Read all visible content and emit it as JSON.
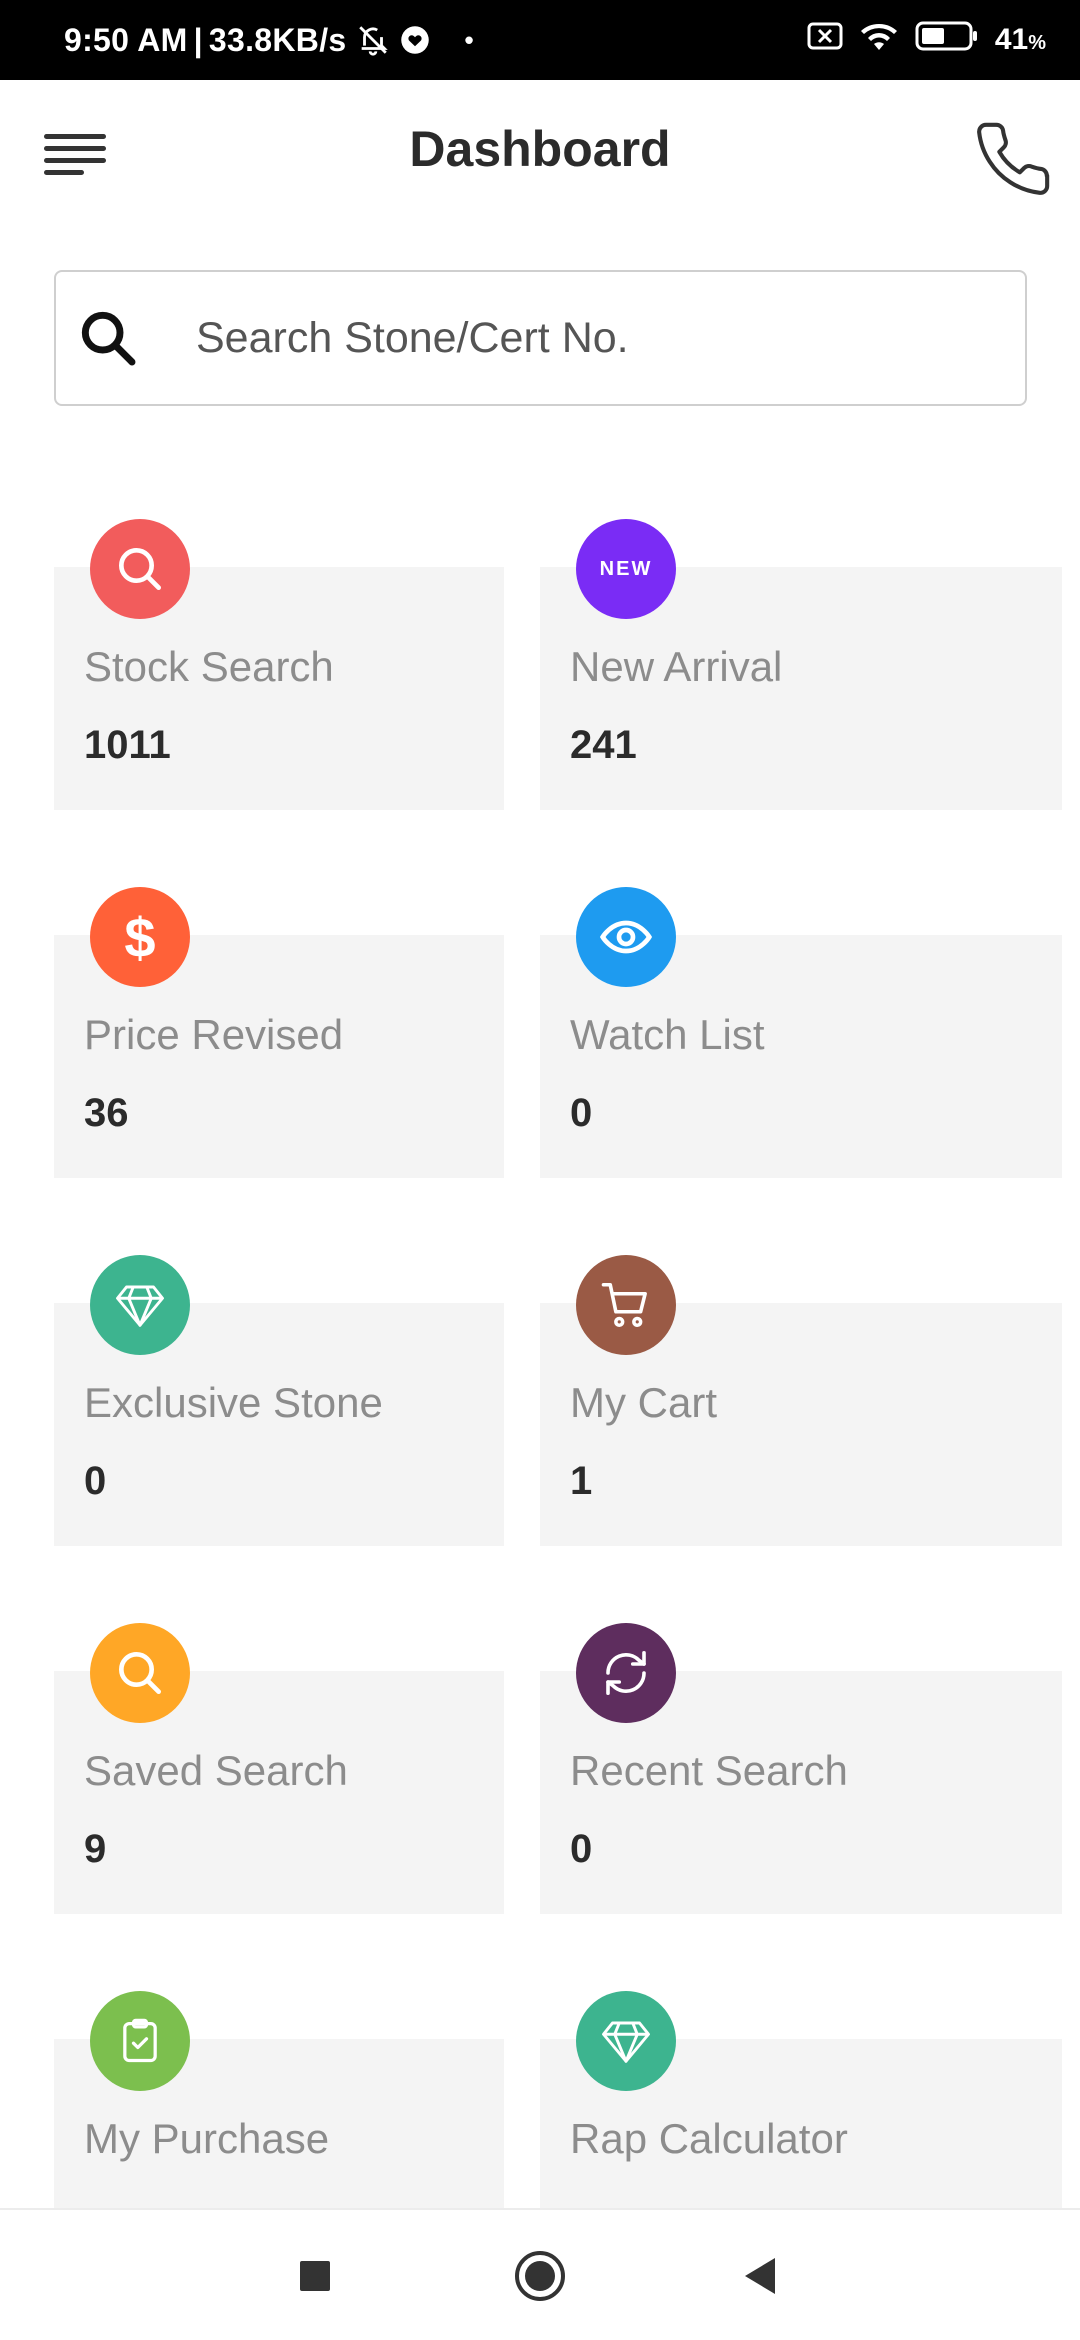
{
  "status_bar": {
    "time": "9:50 AM",
    "separator": "|",
    "speed": "33.8KB/s",
    "dot": "•",
    "battery_percent": "41",
    "battery_unit": "%"
  },
  "header": {
    "title": "Dashboard"
  },
  "search": {
    "placeholder": "Search Stone/Cert No."
  },
  "colors": {
    "stock_search": "#F25C5C",
    "new_arrival": "#7A2CF5",
    "price_revised": "#FF6138",
    "watch_list": "#1E9BF0",
    "exclusive_stone": "#3DB48F",
    "my_cart": "#9A5A45",
    "saved_search": "#FFA726",
    "recent_search": "#5E2D5E",
    "my_purchase": "#7CBF4E",
    "rap_calculator": "#3DB48F"
  },
  "cards": {
    "stock_search": {
      "label": "Stock Search",
      "count": "1011",
      "icon": "search-icon"
    },
    "new_arrival": {
      "label": "New Arrival",
      "count": "241",
      "icon": "new-badge-icon",
      "badge_text": "NEW"
    },
    "price_revised": {
      "label": "Price Revised",
      "count": "36",
      "icon": "dollar-icon",
      "symbol": "$"
    },
    "watch_list": {
      "label": "Watch List",
      "count": "0",
      "icon": "eye-icon"
    },
    "exclusive_stone": {
      "label": "Exclusive Stone",
      "count": "0",
      "icon": "diamond-icon"
    },
    "my_cart": {
      "label": "My Cart",
      "count": "1",
      "icon": "cart-icon"
    },
    "saved_search": {
      "label": "Saved Search",
      "count": "9",
      "icon": "search-icon"
    },
    "recent_search": {
      "label": "Recent Search",
      "count": "0",
      "icon": "refresh-icon"
    },
    "my_purchase": {
      "label": "My Purchase",
      "icon": "clipboard-check-icon"
    },
    "rap_calculator": {
      "label": "Rap Calculator",
      "icon": "diamond-icon"
    }
  }
}
